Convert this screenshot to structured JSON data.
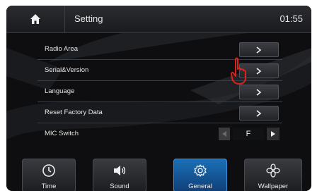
{
  "header": {
    "title": "Setting",
    "time": "01:55",
    "home_icon": "home-icon"
  },
  "settings": {
    "items": [
      {
        "label": "Radio Area",
        "control": "arrow"
      },
      {
        "label": "Serial&Version",
        "control": "arrow"
      },
      {
        "label": "Language",
        "control": "arrow"
      },
      {
        "label": "Reset Factory Data",
        "control": "arrow"
      },
      {
        "label": "MIC Switch",
        "control": "stepper",
        "value": "F"
      }
    ],
    "arrow_glyph": ">"
  },
  "tabs": [
    {
      "label": "Time",
      "icon": "clock-icon",
      "active": false
    },
    {
      "label": "Sound",
      "icon": "speaker-icon",
      "active": false
    },
    {
      "label": "General",
      "icon": "gear-icon",
      "active": true
    },
    {
      "label": "Wallpaper",
      "icon": "flower-icon",
      "active": false
    }
  ],
  "colors": {
    "active_tab": "#1b6fb7",
    "background": "#0e0e10",
    "cursor": "#e0201a"
  }
}
